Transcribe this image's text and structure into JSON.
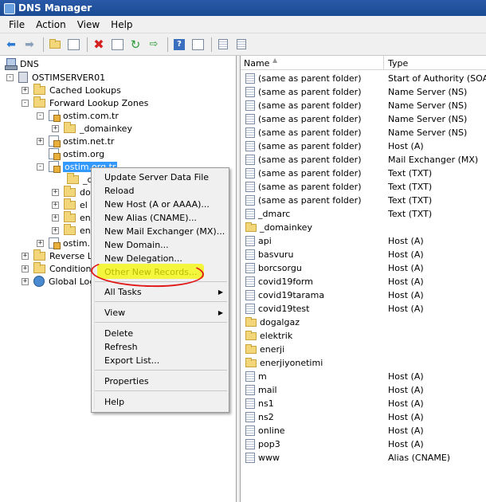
{
  "window": {
    "title": "DNS Manager"
  },
  "menubar": {
    "items": [
      "File",
      "Action",
      "View",
      "Help"
    ]
  },
  "toolbar": {
    "icons": [
      "back-icon",
      "forward-icon",
      "up-folder-icon",
      "show-hide-tree-icon",
      "delete-icon",
      "properties-icon",
      "refresh-icon",
      "export-icon",
      "help-icon",
      "console-icon",
      "record-icon",
      "list-icon"
    ]
  },
  "tree": {
    "root": "DNS",
    "server": "OSTIMSERVER01",
    "cached": "Cached Lookups",
    "forward": "Forward Lookup Zones",
    "zone_com": "ostim.com.tr",
    "domainkey": "_domainkey",
    "zone_net": "ostim.net.tr",
    "zone_org": "ostim.org",
    "zone_org_tr": "ostim.org.tr",
    "child1": "_d",
    "child2": "do",
    "child3": "el",
    "child4": "en",
    "child5": "en",
    "zone_next": "ostim.",
    "reverse": "Reverse L",
    "conditional": "Conditiona",
    "global": "Global Log"
  },
  "context_menu": {
    "items": [
      "Update Server Data File",
      "Reload",
      "New Host (A or AAAA)...",
      "New Alias (CNAME)...",
      "New Mail Exchanger (MX)...",
      "New Domain...",
      "New Delegation...",
      "Other New Records...",
      "All Tasks",
      "View",
      "Delete",
      "Refresh",
      "Export List...",
      "Properties",
      "Help"
    ]
  },
  "list": {
    "col_name": "Name",
    "col_type": "Type",
    "rows": [
      {
        "name": "(same as parent folder)",
        "type": "Start of Authority (SOA)",
        "kind": "record"
      },
      {
        "name": "(same as parent folder)",
        "type": "Name Server (NS)",
        "kind": "record"
      },
      {
        "name": "(same as parent folder)",
        "type": "Name Server (NS)",
        "kind": "record"
      },
      {
        "name": "(same as parent folder)",
        "type": "Name Server (NS)",
        "kind": "record"
      },
      {
        "name": "(same as parent folder)",
        "type": "Name Server (NS)",
        "kind": "record"
      },
      {
        "name": "(same as parent folder)",
        "type": "Host (A)",
        "kind": "record"
      },
      {
        "name": "(same as parent folder)",
        "type": "Mail Exchanger (MX)",
        "kind": "record"
      },
      {
        "name": "(same as parent folder)",
        "type": "Text (TXT)",
        "kind": "record"
      },
      {
        "name": "(same as parent folder)",
        "type": "Text (TXT)",
        "kind": "record"
      },
      {
        "name": "(same as parent folder)",
        "type": "Text (TXT)",
        "kind": "record"
      },
      {
        "name": "_dmarc",
        "type": "Text (TXT)",
        "kind": "record"
      },
      {
        "name": "_domainkey",
        "type": "",
        "kind": "folder"
      },
      {
        "name": "api",
        "type": "Host (A)",
        "kind": "record"
      },
      {
        "name": "basvuru",
        "type": "Host (A)",
        "kind": "record"
      },
      {
        "name": "borcsorgu",
        "type": "Host (A)",
        "kind": "record"
      },
      {
        "name": "covid19form",
        "type": "Host (A)",
        "kind": "record"
      },
      {
        "name": "covid19tarama",
        "type": "Host (A)",
        "kind": "record"
      },
      {
        "name": "covid19test",
        "type": "Host (A)",
        "kind": "record"
      },
      {
        "name": "dogalgaz",
        "type": "",
        "kind": "folder"
      },
      {
        "name": "elektrik",
        "type": "",
        "kind": "folder"
      },
      {
        "name": "enerji",
        "type": "",
        "kind": "folder"
      },
      {
        "name": "enerjiyonetimi",
        "type": "",
        "kind": "folder"
      },
      {
        "name": "m",
        "type": "Host (A)",
        "kind": "record"
      },
      {
        "name": "mail",
        "type": "Host (A)",
        "kind": "record"
      },
      {
        "name": "ns1",
        "type": "Host (A)",
        "kind": "record"
      },
      {
        "name": "ns2",
        "type": "Host (A)",
        "kind": "record"
      },
      {
        "name": "online",
        "type": "Host (A)",
        "kind": "record"
      },
      {
        "name": "pop3",
        "type": "Host (A)",
        "kind": "record"
      },
      {
        "name": "www",
        "type": "Alias (CNAME)",
        "kind": "record"
      }
    ]
  },
  "colors": {
    "selection": "#3399ff",
    "highlight": "#f4f800",
    "annotation": "#e01818"
  }
}
